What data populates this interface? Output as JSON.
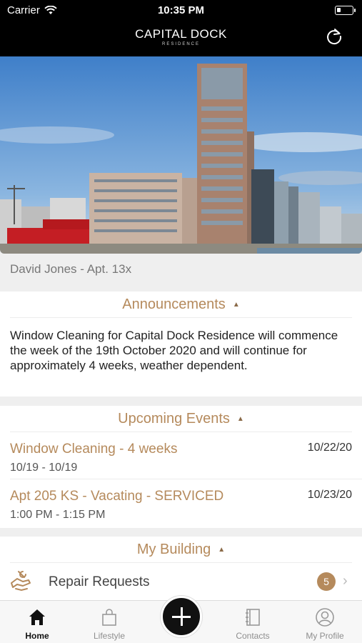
{
  "status_bar": {
    "carrier": "Carrier",
    "time": "10:35 PM"
  },
  "header": {
    "brand_name": "CAPITAL DOCK",
    "brand_sub": "RESIDENCE",
    "refresh_icon": "refresh-icon"
  },
  "resident": {
    "label": "David Jones - Apt. 13x"
  },
  "announcements": {
    "title": "Announcements",
    "caret": "▲",
    "body": "Window Cleaning for Capital Dock Residence will commence the week of the 19th October 2020 and will continue for approximately 4 weeks, weather dependent."
  },
  "events": {
    "title": "Upcoming Events",
    "caret": "▲",
    "items": [
      {
        "title": "Window Cleaning - 4 weeks",
        "range": "10/19 - 10/19",
        "date": "10/22/20"
      },
      {
        "title": "Apt 205 KS - Vacating - SERVICED",
        "range": "1:00 PM - 1:15 PM",
        "date": "10/23/20"
      }
    ]
  },
  "building": {
    "title": "My Building",
    "caret": "▲",
    "items": [
      {
        "label": "Repair Requests",
        "badge": "5",
        "chevron": "›"
      }
    ]
  },
  "tabs": [
    {
      "label": "Home",
      "icon": "home-icon",
      "active": true
    },
    {
      "label": "Lifestyle",
      "icon": "shopping-bag-icon",
      "active": false
    },
    {
      "label": "Contacts",
      "icon": "address-book-icon",
      "active": false
    },
    {
      "label": "My Profile",
      "icon": "user-circle-icon",
      "active": false
    }
  ],
  "colors": {
    "accent": "#b58a5c",
    "header_bg": "#000000",
    "badge": "#b58a5c"
  }
}
